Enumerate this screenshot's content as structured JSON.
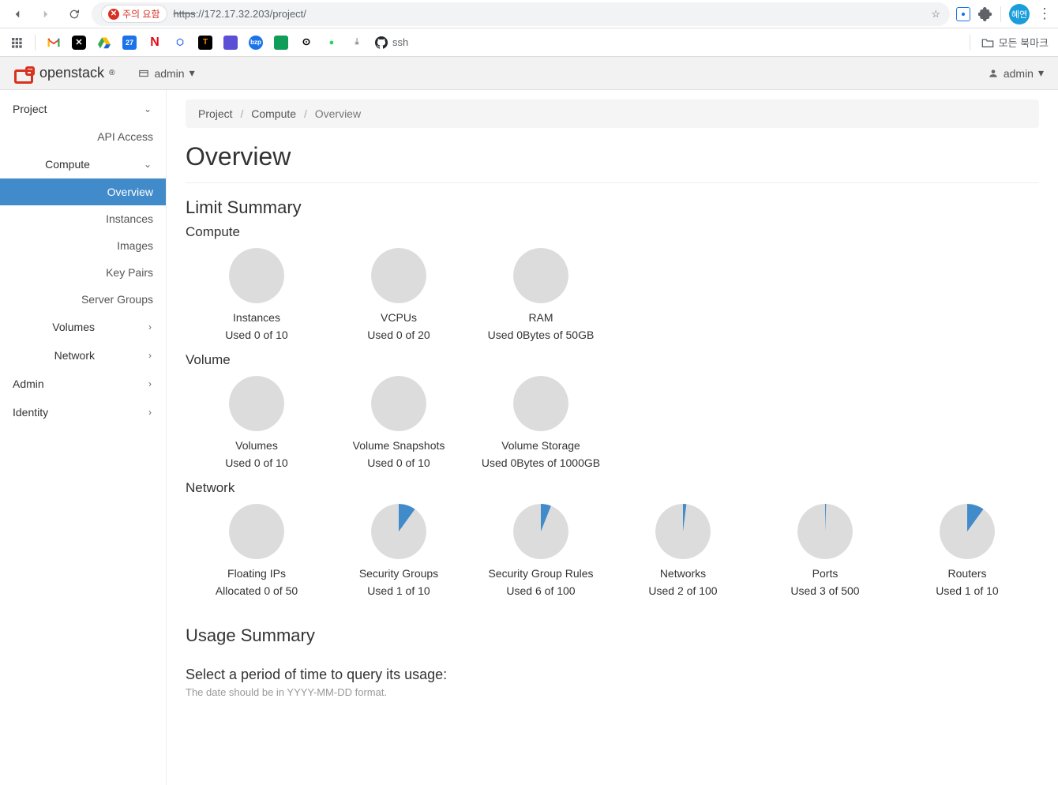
{
  "browser": {
    "warn_label": "주의 요함",
    "url_scheme": "https",
    "url_rest": "://172.17.32.203/project/",
    "all_bookmarks": "모든 북마크",
    "avatar_initial": "혜연",
    "github_label": "ssh"
  },
  "topbar": {
    "brand": "openstack",
    "project_label": "admin",
    "user_label": "admin"
  },
  "sidebar": {
    "project": "Project",
    "api_access": "API Access",
    "compute": "Compute",
    "overview": "Overview",
    "instances": "Instances",
    "images": "Images",
    "key_pairs": "Key Pairs",
    "server_groups": "Server Groups",
    "volumes": "Volumes",
    "network": "Network",
    "admin": "Admin",
    "identity": "Identity"
  },
  "breadcrumb": {
    "a": "Project",
    "b": "Compute",
    "c": "Overview"
  },
  "page": {
    "title": "Overview",
    "limit_summary": "Limit Summary",
    "compute_h": "Compute",
    "volume_h": "Volume",
    "network_h": "Network",
    "usage_summary": "Usage Summary",
    "usage_desc": "Select a period of time to query its usage:",
    "usage_note": "The date should be in YYYY-MM-DD format."
  },
  "quotas": {
    "compute": [
      {
        "label": "Instances",
        "text": "Used 0 of 10",
        "used": 0,
        "max": 10
      },
      {
        "label": "VCPUs",
        "text": "Used 0 of 20",
        "used": 0,
        "max": 20
      },
      {
        "label": "RAM",
        "text": "Used 0Bytes of 50GB",
        "used": 0,
        "max": 50
      }
    ],
    "volume": [
      {
        "label": "Volumes",
        "text": "Used 0 of 10",
        "used": 0,
        "max": 10
      },
      {
        "label": "Volume Snapshots",
        "text": "Used 0 of 10",
        "used": 0,
        "max": 10
      },
      {
        "label": "Volume Storage",
        "text": "Used 0Bytes of 1000GB",
        "used": 0,
        "max": 1000
      }
    ],
    "network": [
      {
        "label": "Floating IPs",
        "text": "Allocated 0 of 50",
        "used": 0,
        "max": 50
      },
      {
        "label": "Security Groups",
        "text": "Used 1 of 10",
        "used": 1,
        "max": 10
      },
      {
        "label": "Security Group Rules",
        "text": "Used 6 of 100",
        "used": 6,
        "max": 100
      },
      {
        "label": "Networks",
        "text": "Used 2 of 100",
        "used": 2,
        "max": 100
      },
      {
        "label": "Ports",
        "text": "Used 3 of 500",
        "used": 3,
        "max": 500
      },
      {
        "label": "Routers",
        "text": "Used 1 of 10",
        "used": 1,
        "max": 10
      }
    ]
  }
}
